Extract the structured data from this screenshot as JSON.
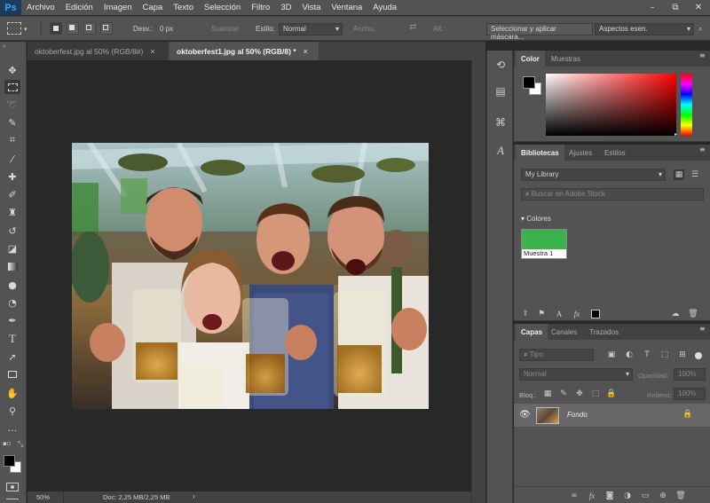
{
  "app": {
    "logo": "Ps"
  },
  "menu": [
    "Archivo",
    "Edición",
    "Imagen",
    "Capa",
    "Texto",
    "Selección",
    "Filtro",
    "3D",
    "Vista",
    "Ventana",
    "Ayuda"
  ],
  "window_controls": {
    "minimize": "–",
    "restore": "⧉",
    "close": "✕"
  },
  "options": {
    "feather_label": "Desv.:",
    "feather_value": "0 px",
    "smooth_label": "Suavizar",
    "style_label": "Estilo:",
    "style_value": "Normal",
    "width_label": "Anchu.:",
    "height_label": "Alt.:",
    "select_mask_button": "Seleccionar y aplicar máscara...",
    "workspace_value": "Aspectos esen."
  },
  "tabs": [
    {
      "label": "oktoberfest.jpg al 50% (RGB/8#)",
      "close": "×"
    },
    {
      "label": "oktoberfest1.jpg al 50% (RGB/8) *",
      "close": "×"
    }
  ],
  "status": {
    "zoom": "50%",
    "doc_info": "Doc: 2,25 MB/2,25 MB"
  },
  "color_panel": {
    "tabs": [
      "Color",
      "Muestras"
    ],
    "foreground": "#000000",
    "background": "#ffffff"
  },
  "libraries_panel": {
    "tabs": [
      "Bibliotecas",
      "Ajustes",
      "Estilos"
    ],
    "library_select": "My Library",
    "search_placeholder": "Buscar en Adobe Stock",
    "section_label": "Colores",
    "swatch_label": "Muestra 1",
    "swatch_color": "#3db14a"
  },
  "layers_panel": {
    "tabs": [
      "Capas",
      "Canales",
      "Trazados"
    ],
    "filter_label": "Tipo",
    "blend_mode": "Normal",
    "opacity_label": "Opacidad:",
    "opacity_value": "100%",
    "lock_label": "Bloq.:",
    "fill_label": "Relleno:",
    "fill_value": "100%",
    "layer_name": "Fondo"
  },
  "tool_icons": [
    "move-icon",
    "marquee-icon",
    "lasso-icon",
    "quick-select-icon",
    "crop-icon",
    "eyedropper-icon",
    "healing-icon",
    "brush-icon",
    "stamp-icon",
    "history-brush-icon",
    "eraser-icon",
    "gradient-icon",
    "blur-icon",
    "dodge-icon",
    "pen-icon",
    "text-icon",
    "path-select-icon",
    "rectangle-icon",
    "hand-icon",
    "zoom-icon",
    "more-tools-icon"
  ]
}
